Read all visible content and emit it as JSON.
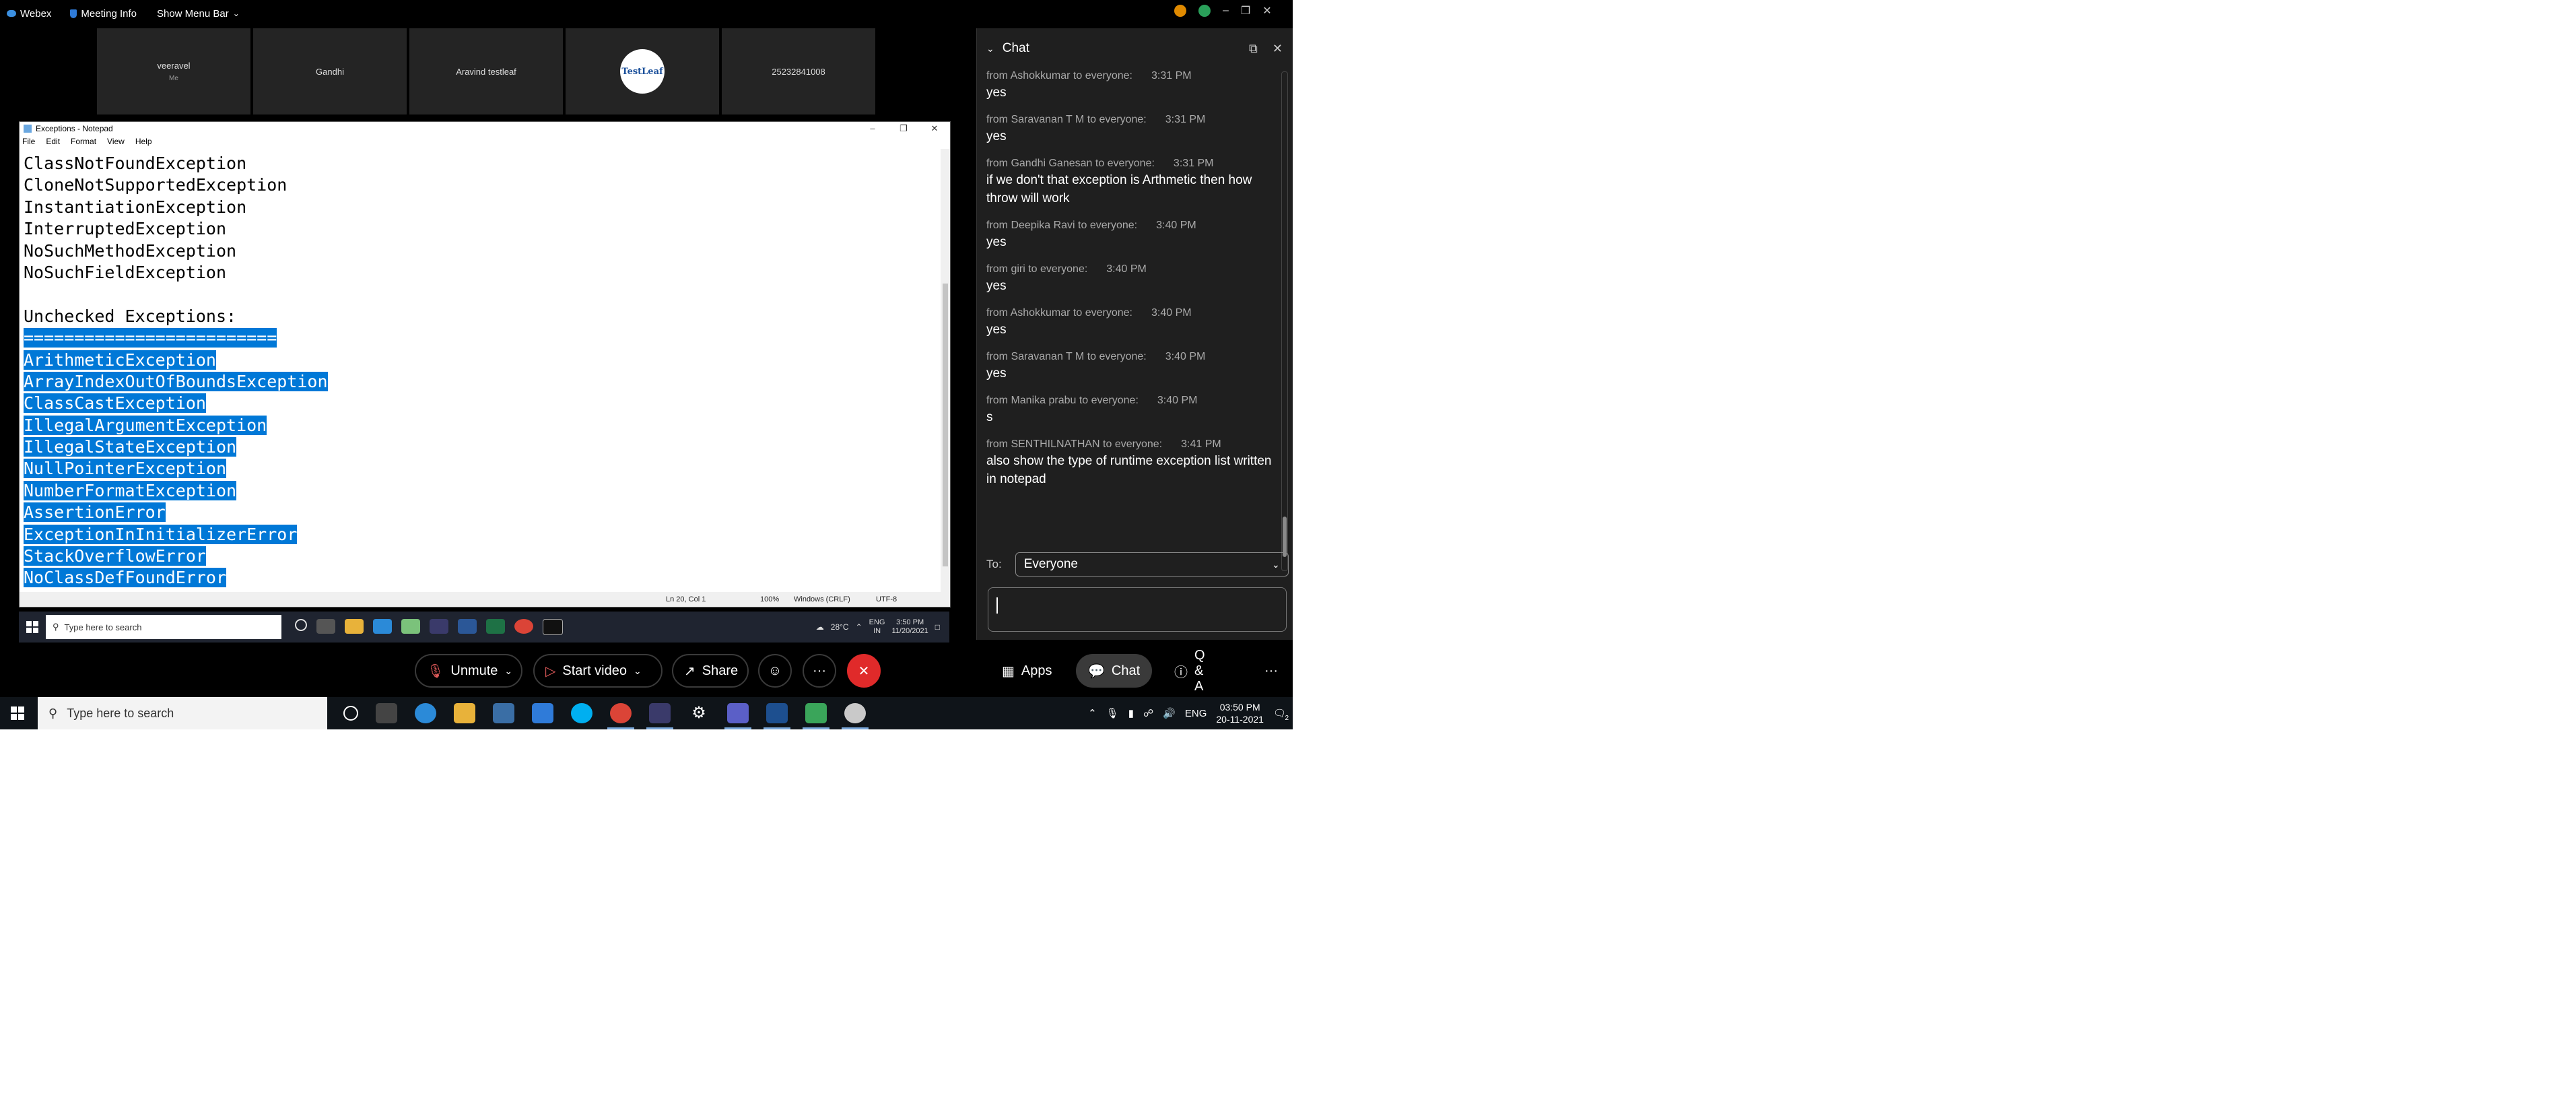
{
  "topbar": {
    "app_name": "Webex",
    "meeting_info": "Meeting Info",
    "show_menu_bar": "Show Menu Bar"
  },
  "participants": [
    {
      "name": "veeravel",
      "sub": "Me"
    },
    {
      "name": "Gandhi",
      "sub": ""
    },
    {
      "name": "Aravind testleaf",
      "sub": ""
    },
    {
      "name": "",
      "sub": "",
      "logo_text": "TestLeaf"
    },
    {
      "name": "25232841008",
      "sub": ""
    }
  ],
  "notepad": {
    "title": "Exceptions - Notepad",
    "menu": [
      "File",
      "Edit",
      "Format",
      "View",
      "Help"
    ],
    "lines": [
      {
        "text": "ClassNotFoundException",
        "selected": false
      },
      {
        "text": "CloneNotSupportedException",
        "selected": false
      },
      {
        "text": "InstantiationException",
        "selected": false
      },
      {
        "text": "InterruptedException",
        "selected": false
      },
      {
        "text": "NoSuchMethodException",
        "selected": false
      },
      {
        "text": "NoSuchFieldException",
        "selected": false
      },
      {
        "text": "",
        "selected": false
      },
      {
        "text": "Unchecked Exceptions:",
        "selected": false
      },
      {
        "text": "=========================",
        "selected": true
      },
      {
        "text": "ArithmeticException",
        "selected": true
      },
      {
        "text": "ArrayIndexOutOfBoundsException",
        "selected": true
      },
      {
        "text": "ClassCastException",
        "selected": true
      },
      {
        "text": "IllegalArgumentException",
        "selected": true
      },
      {
        "text": "IllegalStateException",
        "selected": true
      },
      {
        "text": "NullPointerException",
        "selected": true
      },
      {
        "text": "NumberFormatException",
        "selected": true
      },
      {
        "text": "AssertionError",
        "selected": true
      },
      {
        "text": "ExceptionInInitializerError",
        "selected": true
      },
      {
        "text": "StackOverflowError",
        "selected": true
      },
      {
        "text": "NoClassDefFoundError",
        "selected": true
      }
    ],
    "status": {
      "position": "Ln 20, Col 1",
      "zoom": "100%",
      "line_ending": "Windows (CRLF)",
      "encoding": "UTF-8"
    }
  },
  "inner_taskbar": {
    "search_placeholder": "Type here to search",
    "weather": "28°C",
    "lang": "ENG",
    "lang_sub": "IN",
    "time": "3:50 PM",
    "date": "11/20/2021"
  },
  "controls": {
    "unmute": "Unmute",
    "start_video": "Start video",
    "share": "Share",
    "more": "···",
    "apps": "Apps",
    "chat": "Chat",
    "qa": "Q & A",
    "overflow": "···"
  },
  "chat": {
    "title": "Chat",
    "messages": [
      {
        "from": "from Ashokkumar to everyone:",
        "time": "3:31 PM",
        "body": "yes"
      },
      {
        "from": "from Saravanan T M to everyone:",
        "time": "3:31 PM",
        "body": "yes"
      },
      {
        "from": "from Gandhi Ganesan to everyone:",
        "time": "3:31 PM",
        "body": "if we don't that exception is Arthmetic then how throw will work"
      },
      {
        "from": "from Deepika Ravi to everyone:",
        "time": "3:40 PM",
        "body": "yes"
      },
      {
        "from": "from giri to everyone:",
        "time": "3:40 PM",
        "body": "yes"
      },
      {
        "from": "from Ashokkumar to everyone:",
        "time": "3:40 PM",
        "body": "yes"
      },
      {
        "from": "from Saravanan T M to everyone:",
        "time": "3:40 PM",
        "body": "yes"
      },
      {
        "from": "from Manika prabu to everyone:",
        "time": "3:40 PM",
        "body": "s"
      },
      {
        "from": "from SENTHILNATHAN to everyone:",
        "time": "3:41 PM",
        "body": "also show the type of runtime exception list written in notepad"
      }
    ],
    "to_label": "To:",
    "to_value": "Everyone"
  },
  "taskbar": {
    "search_placeholder": "Type here to search",
    "lang": "ENG",
    "time": "03:50 PM",
    "date": "20-11-2021",
    "notif_count": "2"
  },
  "colors": {
    "selection": "#0078d7",
    "end_call": "#e02a2a",
    "chat_bg": "#1f1f1f"
  }
}
